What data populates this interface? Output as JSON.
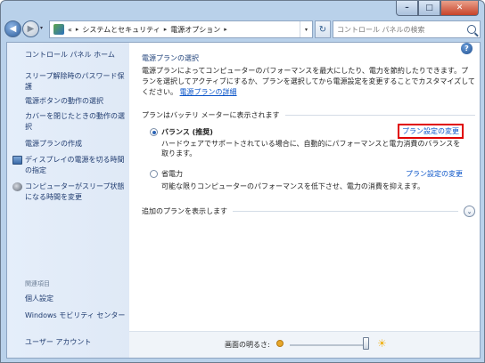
{
  "caption": {
    "min": "–",
    "max": "□",
    "close": "✕"
  },
  "nav": {
    "back": "◀",
    "forward": "▶",
    "dropdown": "▾"
  },
  "address": {
    "prefix": "«",
    "crumbs": [
      "システムとセキュリティ",
      "電源オプション"
    ],
    "separator": "▸"
  },
  "search": {
    "placeholder": "コントロール パネルの検索"
  },
  "sidebar": {
    "home": "コントロール パネル ホーム",
    "items": [
      {
        "label": "スリープ解除時のパスワード保護"
      },
      {
        "label": "電源ボタンの動作の選択"
      },
      {
        "label": "カバーを閉じたときの動作の選択"
      },
      {
        "label": "電源プランの作成"
      },
      {
        "label": "ディスプレイの電源を切る時間の指定"
      },
      {
        "label": "コンピューターがスリープ状態になる時間を変更"
      }
    ],
    "related_header": "関連項目",
    "related": [
      {
        "label": "個人設定"
      },
      {
        "label": "Windows モビリティ センター"
      },
      {
        "label": "ユーザー アカウント"
      }
    ]
  },
  "main": {
    "title": "電源プランの選択",
    "description": "電源プランによってコンピューターのパフォーマンスを最大にしたり、電力を節約したりできます。プランを選択してアクティブにするか、プランを選択してから電源設定を変更することでカスタマイズしてください。",
    "description_link": "電源プランの詳細",
    "group_header": "プランはバッテリ メーターに表示されます",
    "plans": [
      {
        "name": "バランス (推奨)",
        "selected": true,
        "description": "ハードウェアでサポートされている場合に、自動的にパフォーマンスと電力消費のバランスを取ります。",
        "link": "プラン設定の変更"
      },
      {
        "name": "省電力",
        "selected": false,
        "description": "可能な限りコンピューターのパフォーマンスを低下させ、電力の消費を抑えます。",
        "link": "プラン設定の変更"
      }
    ],
    "more_plans": "追加のプランを表示します",
    "expand_icon": "chevron-down-icon"
  },
  "brightness": {
    "label": "画面の明るさ:",
    "level": 1.0
  },
  "colors": {
    "link": "#0a54c8",
    "highlight": "#e00000",
    "sidebar_bg": "#e5eefa"
  }
}
